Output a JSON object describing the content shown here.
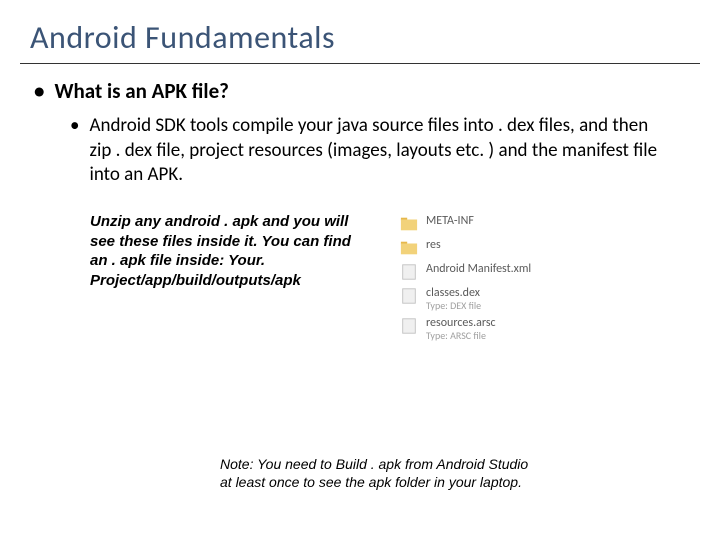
{
  "title": "Android Fundamentals",
  "bullet1": "What is an APK file?",
  "bullet2": "Android SDK tools compile your java source files into . dex files, and then zip . dex file, project resources (images, layouts etc. ) and the manifest file into an APK.",
  "tip": "Unzip any android . apk and you will see these files inside it. You can find an . apk file inside: Your. Project/app/build/outputs/apk",
  "files": [
    {
      "name": "META-INF",
      "type": "",
      "kind": "folder"
    },
    {
      "name": "res",
      "type": "",
      "kind": "folder"
    },
    {
      "name": "Android Manifest.xml",
      "type": "",
      "kind": "file"
    },
    {
      "name": "classes.dex",
      "type": "Type: DEX file",
      "kind": "file"
    },
    {
      "name": "resources.arsc",
      "type": "Type: ARSC file",
      "kind": "file"
    }
  ],
  "note": "Note: You need to Build . apk from Android Studio at least once to see the apk folder in your laptop."
}
